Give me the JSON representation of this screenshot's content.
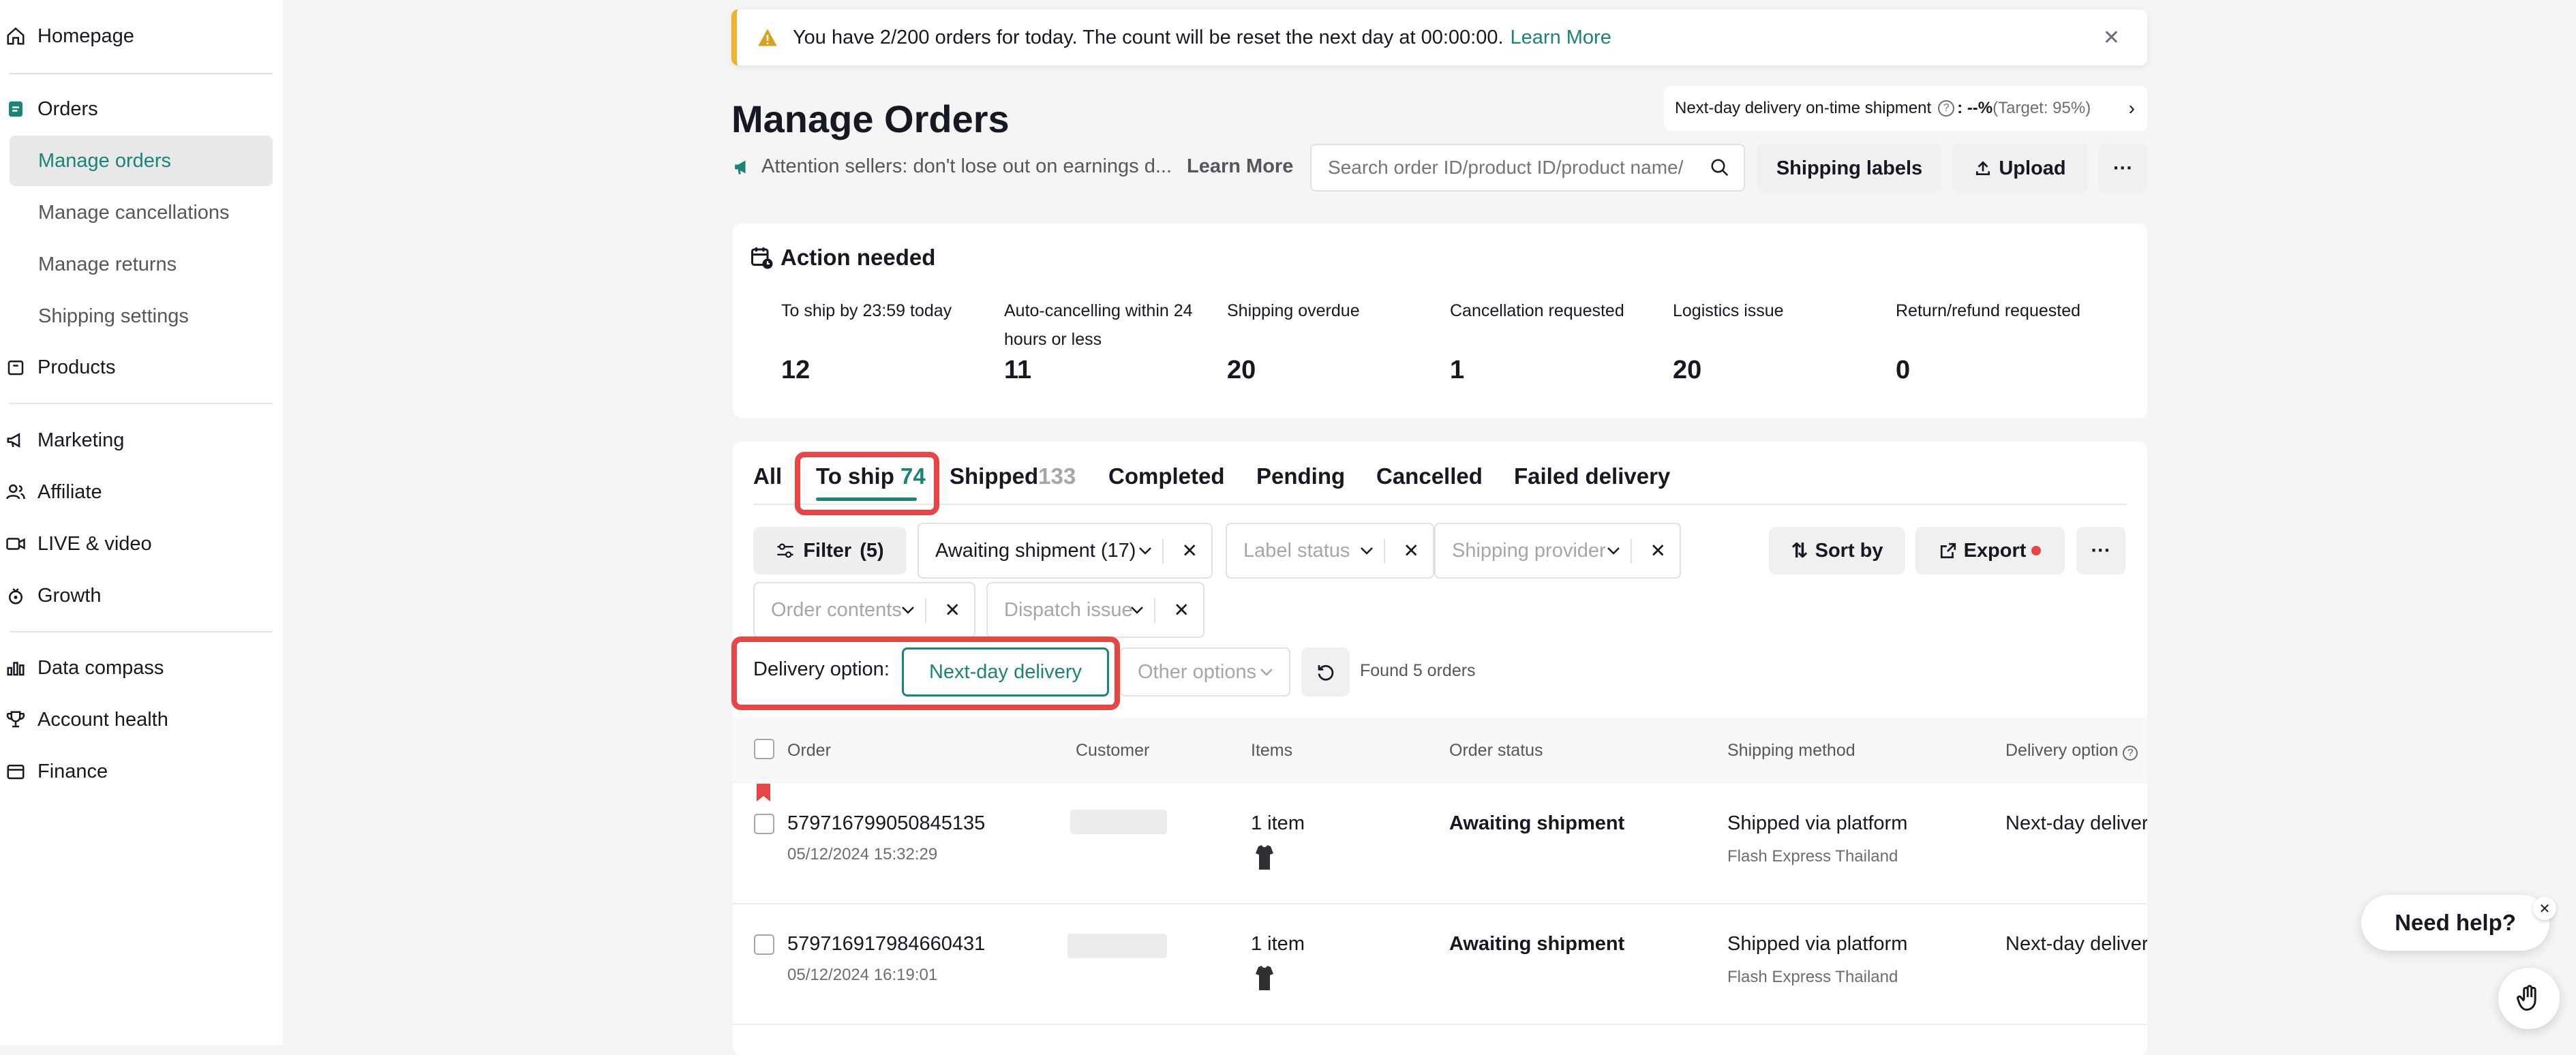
{
  "colors": {
    "accent": "#1a8479",
    "warning": "#f1b12c",
    "alert_red": "#e84545"
  },
  "sidebar": {
    "items": [
      {
        "label": "Homepage",
        "icon": "home-icon"
      },
      {
        "label": "Orders",
        "icon": "orders-icon"
      },
      {
        "label": "Manage orders"
      },
      {
        "label": "Manage cancellations"
      },
      {
        "label": "Manage returns"
      },
      {
        "label": "Shipping settings"
      },
      {
        "label": "Products",
        "icon": "products-icon"
      },
      {
        "label": "Marketing",
        "icon": "megaphone-icon"
      },
      {
        "label": "Affiliate",
        "icon": "people-icon"
      },
      {
        "label": "LIVE & video",
        "icon": "video-icon"
      },
      {
        "label": "Growth",
        "icon": "growth-icon"
      },
      {
        "label": "Data compass",
        "icon": "chart-icon"
      },
      {
        "label": "Account health",
        "icon": "trophy-icon"
      },
      {
        "label": "Finance",
        "icon": "wallet-icon"
      }
    ]
  },
  "banner": {
    "text": "You have 2/200 orders for today. The count will be reset the next day at 00:00:00.",
    "link": "Learn More"
  },
  "header": {
    "title": "Manage Orders",
    "shipment_metric_label": "Next-day delivery on-time shipment",
    "shipment_metric_value": ": --%",
    "shipment_metric_target": "(Target: 95%)",
    "announcement": "Attention sellers: don't lose out on earnings d...",
    "announcement_link": "Learn More",
    "search_placeholder": "Search order ID/product ID/product name/",
    "shipping_labels": "Shipping labels",
    "upload": "Upload",
    "more": "···"
  },
  "action_needed": {
    "title": "Action needed",
    "metrics": [
      {
        "label": "To ship by 23:59 today",
        "value": "12"
      },
      {
        "label": "Auto-cancelling within 24 hours or less",
        "value": "11"
      },
      {
        "label": "Shipping overdue",
        "value": "20"
      },
      {
        "label": "Cancellation requested",
        "value": "1"
      },
      {
        "label": "Logistics issue",
        "value": "20"
      },
      {
        "label": "Return/refund requested",
        "value": "0"
      }
    ]
  },
  "tabs": [
    {
      "label": "All",
      "count": ""
    },
    {
      "label": "To ship",
      "count": "74"
    },
    {
      "label": "Shipped",
      "count": "133"
    },
    {
      "label": "Completed",
      "count": ""
    },
    {
      "label": "Pending",
      "count": ""
    },
    {
      "label": "Cancelled",
      "count": ""
    },
    {
      "label": "Failed delivery",
      "count": ""
    }
  ],
  "filters": {
    "filter_button": "Filter",
    "filter_count": "(5)",
    "awaiting": "Awaiting shipment (17)",
    "label_status": "Label status",
    "shipping_provider": "Shipping provider",
    "order_contents": "Order contents",
    "dispatch_issue": "Dispatch issue",
    "sort_by": "Sort by",
    "export": "Export",
    "more": "···",
    "delivery_option_label": "Delivery option:",
    "next_day": "Next-day delivery",
    "other_options": "Other options",
    "found": "Found 5 orders"
  },
  "table": {
    "columns": [
      "Order",
      "Customer",
      "Items",
      "Order status",
      "Shipping method",
      "Delivery option"
    ],
    "rows": [
      {
        "order_id": "579716799050845135",
        "date": "05/12/2024 15:32:29",
        "items": "1 item",
        "status": "Awaiting shipment",
        "shipping": "Shipped via platform",
        "carrier": "Flash Express Thailand",
        "delivery": "Next-day deliver"
      },
      {
        "order_id": "579716917984660431",
        "date": "05/12/2024 16:19:01",
        "items": "1 item",
        "status": "Awaiting shipment",
        "shipping": "Shipped via platform",
        "carrier": "Flash Express Thailand",
        "delivery": "Next-day deliver"
      }
    ]
  },
  "help": {
    "label": "Need help?"
  }
}
